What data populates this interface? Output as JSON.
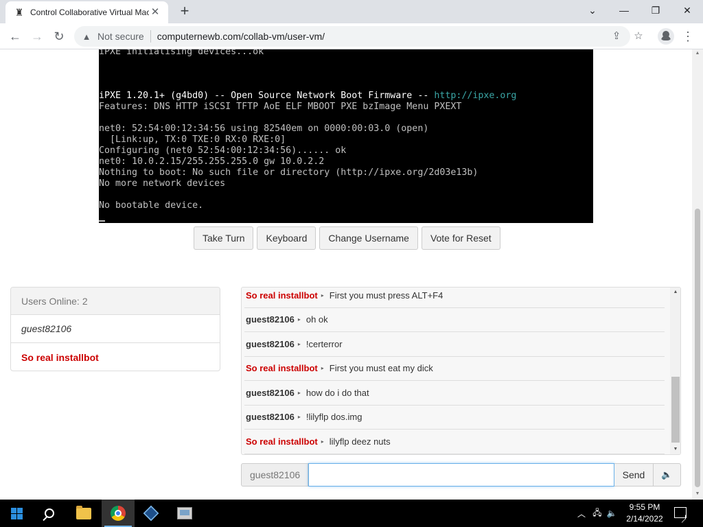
{
  "browser": {
    "tab_title": "Control Collaborative Virtual Machine",
    "new_tab_label": "+",
    "security_label": "Not secure",
    "url": "computernewb.com/collab-vm/user-vm/",
    "window_controls": {
      "minimize": "—",
      "restore": "❐",
      "close": "✕",
      "tabsearch": "⌄"
    },
    "icons": [
      "back-icon",
      "forward-icon",
      "reload-icon",
      "warning-icon",
      "share-icon",
      "star-icon",
      "profile-icon",
      "menu-icon"
    ]
  },
  "vm": {
    "console_lines": [
      {
        "text": "iPXE initialising devices...ok",
        "bright": false
      },
      {
        "text": "",
        "bright": false
      },
      {
        "text": "",
        "bright": false
      },
      {
        "text": "",
        "bright": false
      },
      {
        "text": "iPXE 1.20.1+ (g4bd0) -- Open Source Network Boot Firmware -- ",
        "bright": true,
        "link": "http://ipxe.org"
      },
      {
        "text": "Features: DNS HTTP iSCSI TFTP AoE ELF MBOOT PXE bzImage Menu PXEXT",
        "bright": false
      },
      {
        "text": "",
        "bright": false
      },
      {
        "text": "net0: 52:54:00:12:34:56 using 82540em on 0000:00:03.0 (open)",
        "bright": false
      },
      {
        "text": "  [Link:up, TX:0 TXE:0 RX:0 RXE:0]",
        "bright": false
      },
      {
        "text": "Configuring (net0 52:54:00:12:34:56)...... ok",
        "bright": false
      },
      {
        "text": "net0: 10.0.2.15/255.255.255.0 gw 10.0.2.2",
        "bright": false
      },
      {
        "text": "Nothing to boot: No such file or directory (http://ipxe.org/2d03e13b)",
        "bright": false
      },
      {
        "text": "No more network devices",
        "bright": false
      },
      {
        "text": "",
        "bright": false
      },
      {
        "text": "No bootable device.",
        "bright": false
      }
    ],
    "buttons": {
      "take_turn": "Take Turn",
      "keyboard": "Keyboard",
      "change_username": "Change Username",
      "vote_reset": "Vote for Reset"
    }
  },
  "users": {
    "header_label": "Users Online:",
    "count": "2",
    "list": [
      "guest82106",
      "So real installbot"
    ]
  },
  "chat": {
    "messages": [
      {
        "user": "So real installbot",
        "text": "First you must press ALT+F4",
        "bot": true
      },
      {
        "user": "guest82106",
        "text": "oh ok",
        "bot": false
      },
      {
        "user": "guest82106",
        "text": "!certerror",
        "bot": false
      },
      {
        "user": "So real installbot",
        "text": "First you must eat my dick",
        "bot": true
      },
      {
        "user": "guest82106",
        "text": "how do i do that",
        "bot": false
      },
      {
        "user": "guest82106",
        "text": "!lilyflp dos.img",
        "bot": false
      },
      {
        "user": "So real installbot",
        "text": "lilyflp deez nuts",
        "bot": true
      }
    ],
    "username": "guest82106",
    "input_value": "",
    "send_label": "Send",
    "sound_icon": "speaker-icon"
  },
  "taskbar": {
    "time": "9:55 PM",
    "date": "2/14/2022",
    "apps": [
      "start-icon",
      "search-icon",
      "file-explorer-icon",
      "chrome-icon",
      "virtualbox-icon",
      "app-icon"
    ]
  },
  "colors": {
    "bot_name": "#cc0000",
    "console_bg": "#000000",
    "console_link": "#3aa6a6",
    "input_focus": "#66afe9"
  }
}
